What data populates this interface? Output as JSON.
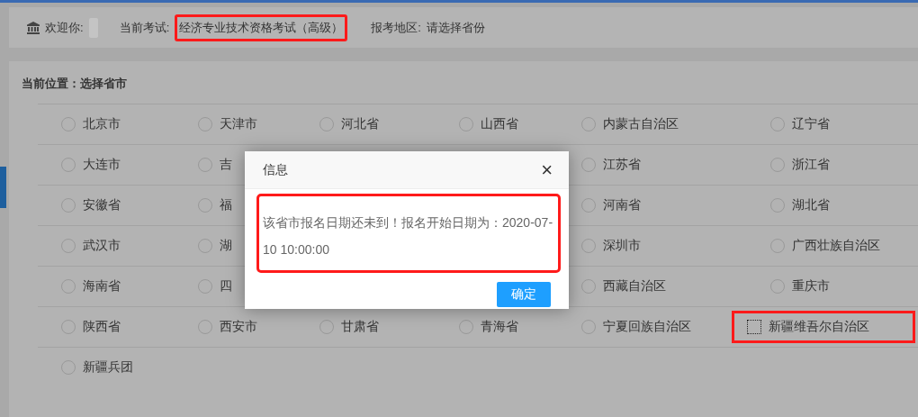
{
  "header": {
    "welcome_label": "欢迎你:",
    "exam_label": "当前考试:",
    "exam_value": "经济专业技术资格考试（高级）",
    "exam_highlighted": true,
    "region_label": "报考地区:",
    "region_value": "请选择省份"
  },
  "breadcrumb": "当前位置：选择省市",
  "regions": [
    {
      "left": [
        {
          "name": "北京市",
          "focused": false,
          "highlighted": false
        },
        {
          "name": "天津市",
          "focused": false,
          "highlighted": false
        },
        {
          "name": "河北省",
          "focused": false,
          "highlighted": false
        },
        {
          "name": "山西省",
          "focused": false,
          "highlighted": false
        },
        {
          "name": "内蒙古自治区",
          "focused": false,
          "highlighted": false
        },
        {
          "name": "辽宁省",
          "focused": false,
          "highlighted": false
        }
      ]
    },
    {
      "left": [
        {
          "name": "大连市",
          "focused": false,
          "highlighted": false
        },
        {
          "name": "吉",
          "focused": false,
          "highlighted": false
        }
      ],
      "right": [
        {
          "name": "江苏省",
          "focused": false,
          "highlighted": false
        },
        {
          "name": "浙江省",
          "focused": false,
          "highlighted": false
        }
      ]
    },
    {
      "left": [
        {
          "name": "安徽省",
          "focused": false,
          "highlighted": false
        },
        {
          "name": "福",
          "focused": false,
          "highlighted": false
        }
      ],
      "right": [
        {
          "name": "河南省",
          "focused": false,
          "highlighted": false
        },
        {
          "name": "湖北省",
          "focused": false,
          "highlighted": false
        }
      ]
    },
    {
      "left": [
        {
          "name": "武汉市",
          "focused": false,
          "highlighted": false
        },
        {
          "name": "湖",
          "focused": false,
          "highlighted": false
        }
      ],
      "right": [
        {
          "name": "深圳市",
          "focused": false,
          "highlighted": false
        },
        {
          "name": "广西壮族自治区",
          "focused": false,
          "highlighted": false
        }
      ]
    },
    {
      "left": [
        {
          "name": "海南省",
          "focused": false,
          "highlighted": false
        },
        {
          "name": "四",
          "focused": false,
          "highlighted": false
        }
      ],
      "right": [
        {
          "name": "西藏自治区",
          "focused": false,
          "highlighted": false
        },
        {
          "name": "重庆市",
          "focused": false,
          "highlighted": false
        }
      ]
    },
    {
      "left": [
        {
          "name": "陕西省",
          "focused": false,
          "highlighted": false
        },
        {
          "name": "西安市",
          "focused": false,
          "highlighted": false
        },
        {
          "name": "甘肃省",
          "focused": false,
          "highlighted": false
        },
        {
          "name": "青海省",
          "focused": false,
          "highlighted": false
        },
        {
          "name": "宁夏回族自治区",
          "focused": false,
          "highlighted": false
        },
        {
          "name": "新疆维吾尔自治区",
          "focused": true,
          "highlighted": true
        }
      ]
    },
    {
      "left": [
        {
          "name": "新疆兵团",
          "focused": false,
          "highlighted": false
        }
      ]
    }
  ],
  "dialog": {
    "title": "信息",
    "close": "×",
    "message": "该省市报名日期还未到！报名开始日期为：2020-07-10 10:00:00",
    "message_highlighted": true,
    "ok_button": "确定"
  }
}
